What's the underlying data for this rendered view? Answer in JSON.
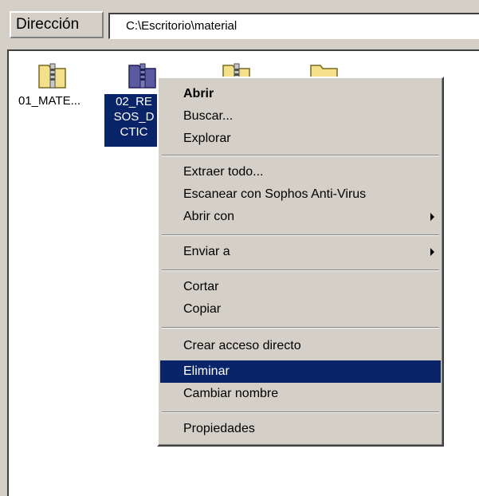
{
  "address_bar": {
    "label": "Dirección",
    "path": "C:\\Escritorio\\material"
  },
  "files": [
    {
      "name": "01_MATE...",
      "icon": "zipped-folder-icon",
      "selected": false
    },
    {
      "name_lines": [
        "02_RE",
        "SOS_D",
        "CTIC"
      ],
      "icon": "zipped-folder-icon",
      "selected": true
    },
    {
      "name": "",
      "icon": "zipped-folder-icon",
      "selected": false
    },
    {
      "name": "",
      "icon": "folder-icon",
      "selected": false
    }
  ],
  "context_menu": {
    "items": [
      {
        "label": "Abrir",
        "bold": true
      },
      {
        "label": "Buscar..."
      },
      {
        "label": "Explorar"
      },
      {
        "label": "Extraer todo..."
      },
      {
        "label": "Escanear con Sophos Anti-Virus"
      },
      {
        "label": "Abrir con",
        "submenu": true
      },
      {
        "label": "Enviar a",
        "submenu": true
      },
      {
        "label": "Cortar"
      },
      {
        "label": "Copiar"
      },
      {
        "label": "Crear acceso directo"
      },
      {
        "label": "Eliminar",
        "highlighted": true
      },
      {
        "label": "Cambiar nombre"
      },
      {
        "label": "Propiedades"
      }
    ]
  },
  "colors": {
    "selection": "#0a246a",
    "face": "#d4d0c8",
    "folder": "#f4e08a"
  }
}
